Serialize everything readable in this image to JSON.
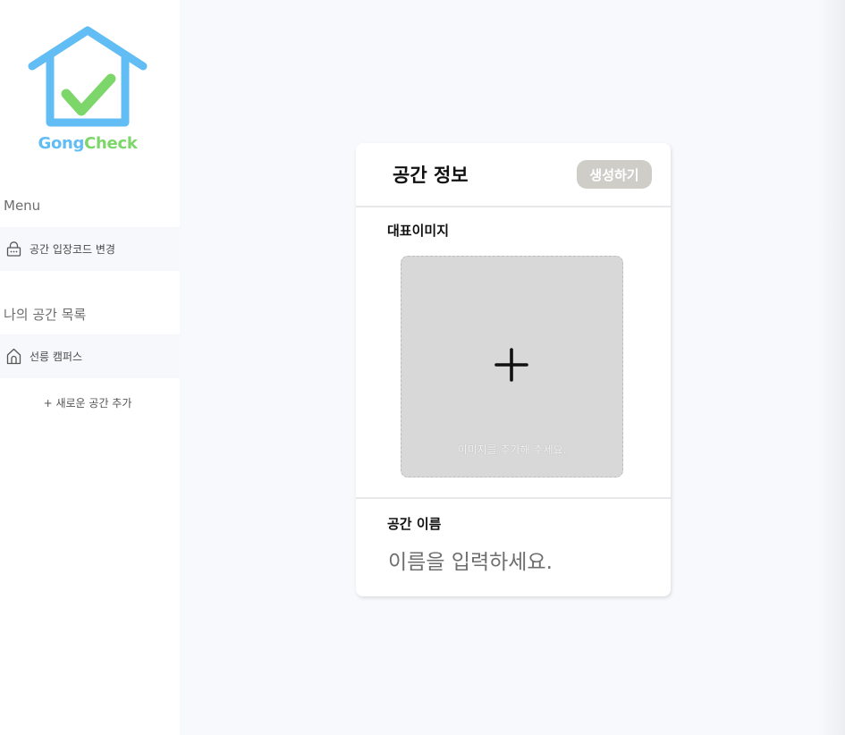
{
  "logo": {
    "text_part1": "Gong",
    "text_part2": "Check",
    "icon": "house-check-icon"
  },
  "sidebar": {
    "menu_title": "Menu",
    "menu_items": [
      {
        "label": "공간 입장코드 변경",
        "icon": "lock-icon"
      }
    ],
    "spaces_title": "나의 공간 목록",
    "space_items": [
      {
        "label": "선릉 캠퍼스",
        "icon": "home-icon"
      }
    ],
    "add_space_label": "+ 새로운 공간 추가"
  },
  "card": {
    "title": "공간 정보",
    "create_button": "생성하기",
    "image_label": "대표이미지",
    "image_hint": "이미지를 추가해 주세요.",
    "name_label": "공간 이름",
    "name_placeholder": "이름을 입력하세요.",
    "name_value": ""
  },
  "colors": {
    "logo_blue": "#62bdf5",
    "logo_green": "#7dd66a",
    "button_bg": "#cfcdc8",
    "upload_bg": "#d8d8d8"
  }
}
